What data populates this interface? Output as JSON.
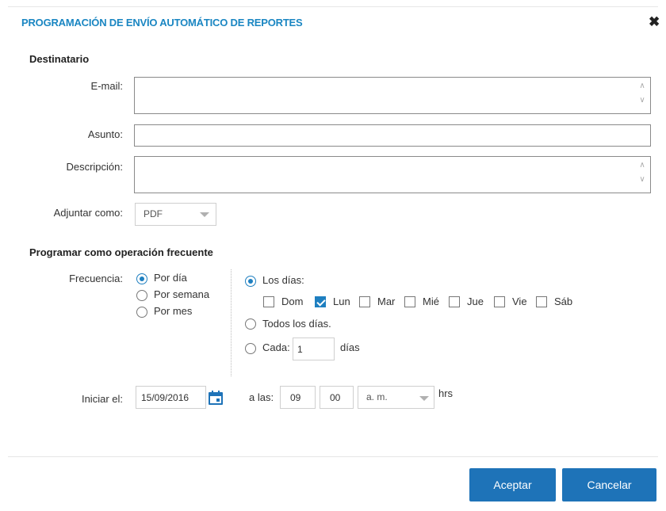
{
  "dialog": {
    "title": "PROGRAMACIÓN DE ENVÍO AUTOMÁTICO DE REPORTES",
    "close": "✖"
  },
  "recipient": {
    "section": "Destinatario",
    "email_label": "E-mail:",
    "email_value": "",
    "subject_label": "Asunto:",
    "subject_value": "",
    "description_label": "Descripción:",
    "description_value": "",
    "attach_label": "Adjuntar como:",
    "attach_value": "PDF"
  },
  "schedule": {
    "section": "Programar como operación frecuente",
    "frequency_label": "Frecuencia:",
    "frequency_options": [
      "Por día",
      "Por semana",
      "Por mes"
    ],
    "frequency_selected": "Por día",
    "days_option": "Los días:",
    "days": [
      {
        "label": "Dom",
        "checked": false
      },
      {
        "label": "Lun",
        "checked": true
      },
      {
        "label": "Mar",
        "checked": false
      },
      {
        "label": "Mié",
        "checked": false
      },
      {
        "label": "Jue",
        "checked": false
      },
      {
        "label": "Vie",
        "checked": false
      },
      {
        "label": "Sáb",
        "checked": false
      }
    ],
    "all_days_option": "Todos los días.",
    "every_option": "Cada:",
    "every_value": "1",
    "every_unit": "días",
    "start_label": "Iniciar el:",
    "start_date": "15/09/2016",
    "at_label": "a las:",
    "hour": "09",
    "minute": "00",
    "ampm": "a. m.",
    "hrs": "hrs"
  },
  "buttons": {
    "accept": "Aceptar",
    "cancel": "Cancelar"
  },
  "colors": {
    "accent": "#1a86c2",
    "button": "#1e73b8"
  }
}
